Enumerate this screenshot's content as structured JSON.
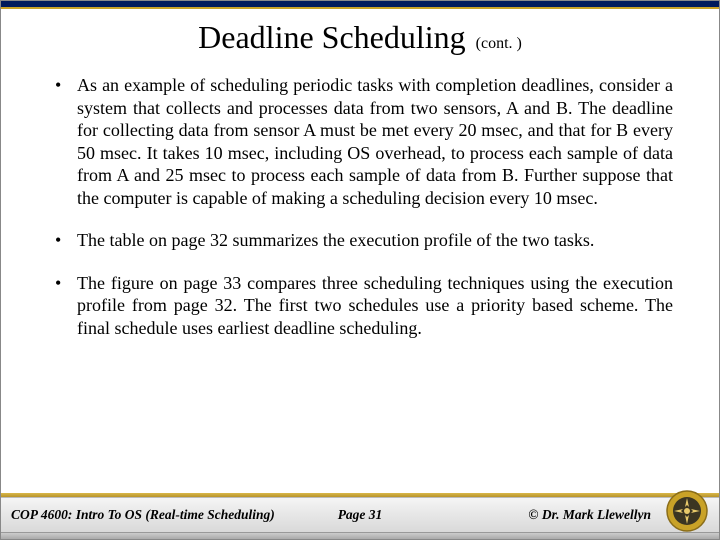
{
  "title": "Deadline Scheduling",
  "title_cont": "(cont. )",
  "bullets": [
    "As an example of scheduling periodic tasks with completion deadlines, consider a system that collects and processes data from two sensors, A and B.  The deadline for collecting data from sensor A must be met every 20 msec, and that for B every 50 msec.  It takes 10 msec, including OS overhead, to process each sample of data from A and 25 msec to process each sample of data from B.  Further suppose that the computer is capable of making a scheduling decision every 10 msec.",
    "The table on page 32 summarizes the execution profile of the two tasks.",
    "The figure on page 33 compares three scheduling techniques using the execution profile from page 32.  The first two schedules use a priority based scheme.  The final schedule uses earliest deadline scheduling."
  ],
  "footer": {
    "left": "COP 4600: Intro To OS  (Real-time Scheduling)",
    "center": "Page 31",
    "right": "© Dr. Mark Llewellyn"
  },
  "logo_name": "ucf-pegasus-seal"
}
